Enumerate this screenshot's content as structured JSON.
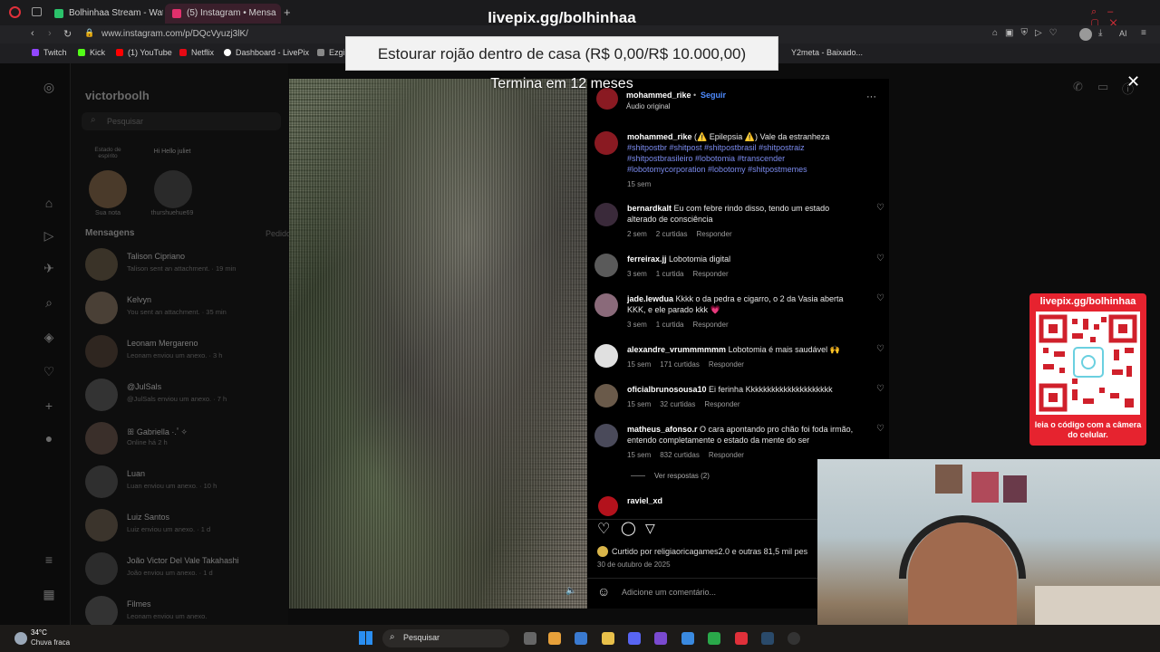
{
  "browser": {
    "tabs": [
      {
        "title": "Bolhinhaa Stream - Watch",
        "active": false
      },
      {
        "title": "(5) Instagram • Mensa",
        "active": true
      }
    ],
    "url": "www.instagram.com/p/DQcVyuzj3lK/",
    "bookmarks": [
      "Twitch",
      "Kick",
      "(1) YouTube",
      "Netflix",
      "Dashboard - LivePix",
      "Ezgi",
      "Y2meta - Baixado..."
    ],
    "ai_label": "AI"
  },
  "instagram": {
    "username": "victorboolh",
    "search_placeholder": "Pesquisar",
    "notes": [
      {
        "note": "Estado de espírito",
        "name": "Sua nota"
      },
      {
        "note": "Hi Hello juliet",
        "name": "thurshuehue69"
      }
    ],
    "messages_label": "Mensagens",
    "requests_label": "Pedidos",
    "conversations": [
      {
        "name": "Talison Cipriano",
        "preview": "Talison sent an attachment. · 19 min"
      },
      {
        "name": "Kelvyn",
        "preview": "You sent an attachment. · 35 min"
      },
      {
        "name": "Leonam Mergareno",
        "preview": "Leonam enviou um anexo. · 3 h"
      },
      {
        "name": "@JulSals",
        "preview": "@JulSals enviou um anexo. · 7 h"
      },
      {
        "name": "ꕥ Gabriella ·.ﾟ✧",
        "preview": "Online há 2 h"
      },
      {
        "name": "Luan",
        "preview": "Luan enviou um anexo. · 10 h"
      },
      {
        "name": "Luiz Santos",
        "preview": "Luiz enviou um anexo. · 1 d"
      },
      {
        "name": "João Victor Del Vale Takahashi",
        "preview": "João enviou um anexo. · 1 d"
      },
      {
        "name": "Filmes",
        "preview": "Leonam enviou um anexo."
      }
    ]
  },
  "overlay": {
    "livepix_url": "livepix.gg/bolhinhaa",
    "goal_text": "Estourar rojão dentro de casa (R$ 0,00/R$ 10.000,00)",
    "ends_text": "Termina em 12 meses",
    "qr_title": "livepix.gg/bolhinhaa",
    "qr_caption": "leia o código com a câmera do celular."
  },
  "post": {
    "author": "mohammed_rike",
    "follow_label": "Seguir",
    "audio_label": "Áudio original",
    "caption_author": "mohammed_rike",
    "caption_text": "(⚠️ Epilepsia ⚠️) Vale da estranheza",
    "caption_tags": "#shitpostbr #shitpost #shitpostbrasil #shitpostraiz #shitpostbrasileiro #lobotomia #transcender #lobotomycorporation #lobotomy #shitpostmemes",
    "caption_time": "15 sem",
    "comments": [
      {
        "user": "bernardkalt",
        "text": "Eu com febre rindo disso, tendo um estado alterado de consciência",
        "time": "2 sem",
        "likes": "2 curtidas",
        "reply": "Responder"
      },
      {
        "user": "ferreirax.jj",
        "text": "Lobotomia digital",
        "time": "3 sem",
        "likes": "1 curtida",
        "reply": "Responder"
      },
      {
        "user": "jade.lewdua",
        "text": "Kkkk o da pedra e cigarro, o 2 da Vasia aberta KKK, e ele parado kkk 💗",
        "time": "3 sem",
        "likes": "1 curtida",
        "reply": "Responder"
      },
      {
        "user": "alexandre_vrummmmmm",
        "text": "Lobotomia é mais saudável 🙌",
        "time": "15 sem",
        "likes": "171 curtidas",
        "reply": "Responder"
      },
      {
        "user": "oficialbrunosousa10",
        "text": "Ei ferinha Kkkkkkkkkkkkkkkkkkkkk",
        "time": "15 sem",
        "likes": "32 curtidas",
        "reply": "Responder"
      },
      {
        "user": "matheus_afonso.r",
        "text": "O cara apontando pro chão foi foda irmão, entendo completamente o estado da mente do ser",
        "time": "15 sem",
        "likes": "832 curtidas",
        "reply": "Responder"
      }
    ],
    "view_replies": "Ver respostas (2)",
    "next_user": "raviel_xd",
    "liked_by": "Curtido por religiaoricagames2.0 e outras 81,5 mil pes",
    "date": "30 de outubro de 2025",
    "add_comment_placeholder": "Adicione um comentário..."
  },
  "taskbar": {
    "weather_temp": "34°C",
    "weather_desc": "Chuva fraca",
    "search_label": "Pesquisar"
  }
}
